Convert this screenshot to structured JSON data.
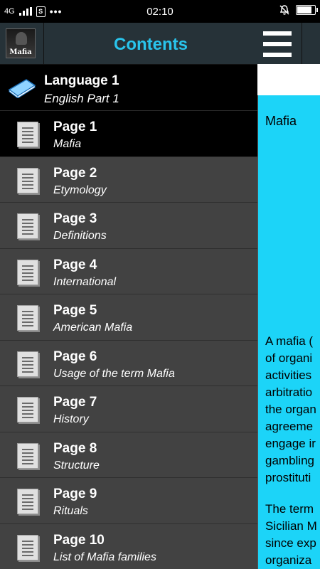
{
  "status_bar": {
    "network": "4G",
    "time": "02:10",
    "sim_icon_text": "S",
    "dots": "•••",
    "battery_level": 0.9
  },
  "drawer": {
    "title": "Contents",
    "app_icon_text": "Mafia",
    "language": {
      "title": "Language 1",
      "subtitle": "English Part 1"
    },
    "items": [
      {
        "title": "Page 1",
        "subtitle": "Mafia",
        "active": true
      },
      {
        "title": "Page 2",
        "subtitle": "Etymology"
      },
      {
        "title": "Page 3",
        "subtitle": "Definitions"
      },
      {
        "title": "Page 4",
        "subtitle": "International"
      },
      {
        "title": "Page 5",
        "subtitle": "American Mafia"
      },
      {
        "title": "Page 6",
        "subtitle": "Usage of the term Mafia"
      },
      {
        "title": "Page 7",
        "subtitle": "History"
      },
      {
        "title": "Page 8",
        "subtitle": "Structure"
      },
      {
        "title": "Page 9",
        "subtitle": "Rituals"
      },
      {
        "title": "Page 10",
        "subtitle": "List of Mafia families"
      }
    ]
  },
  "content": {
    "title": "Mafia",
    "paragraph1": [
      "A mafia (",
      "of organi",
      "activities",
      "arbitratio",
      "the organ",
      "agreeme",
      "engage ir",
      "gambling",
      "prostituti"
    ],
    "paragraph2": [
      "The term",
      "Sicilian M",
      "since exp",
      "organiza"
    ]
  },
  "colors": {
    "accent": "#29c4ec",
    "content_bg": "#1cd4f8",
    "drawer_bg": "#424242",
    "header_bg": "#263238"
  }
}
